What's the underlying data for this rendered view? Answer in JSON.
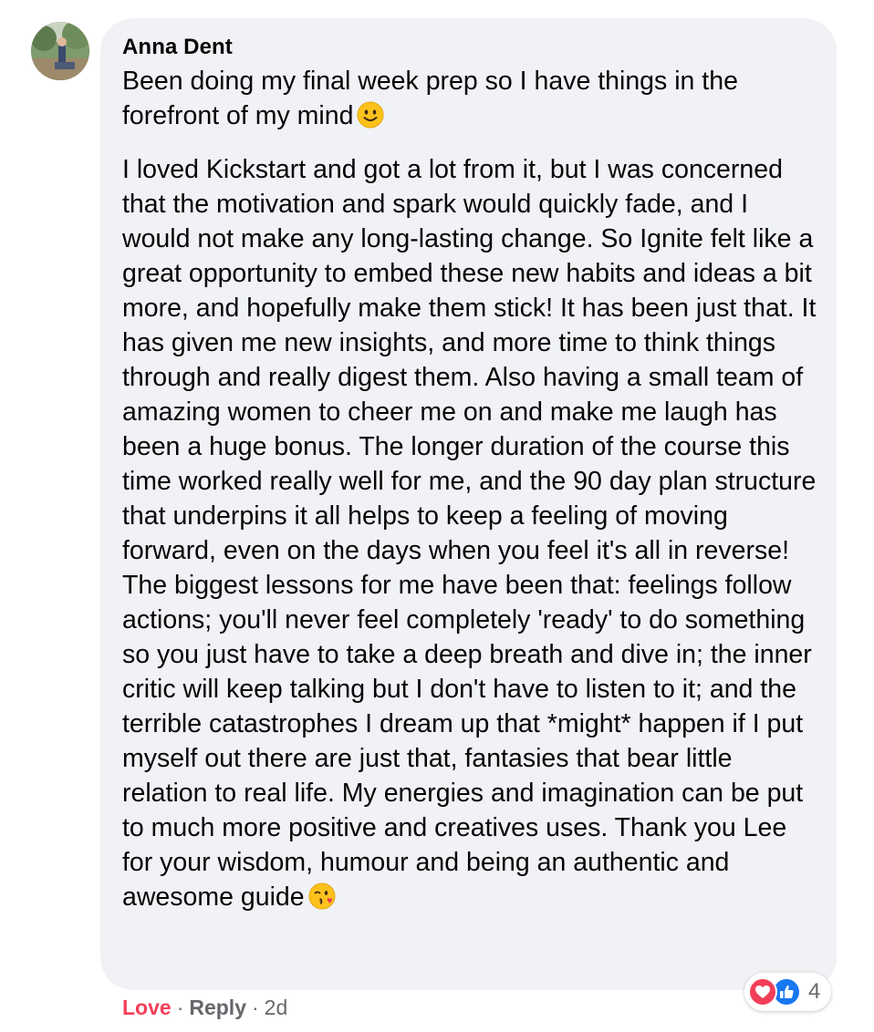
{
  "comment": {
    "author": "Anna Dent",
    "paragraphs": [
      "Been doing my final week prep so I have things in the forefront of my mind",
      "I loved Kickstart and got a lot from it, but I was concerned that the motivation and spark would quickly fade, and I would not make any long-lasting change. So Ignite felt like a great opportunity to embed these new habits and ideas a bit more, and hopefully make them stick! It has been just that. It has given me new insights, and more time to think things through and really digest them. Also having a small team of amazing women to cheer me on and make me laugh has been a huge bonus. The longer duration of the course this time worked really well for me, and the 90 day plan structure that underpins it all helps to keep a feeling of moving forward, even on the days when you feel it's all in reverse! The biggest lessons for me have been that: feelings follow actions; you'll never feel completely 'ready' to do something so you just have to take a deep breath and dive in; the inner critic will keep talking but I don't have to listen to it; and the terrible catastrophes I dream up that *might* happen if I put myself out there are just that, fantasies that bear little relation to real life. My energies and imagination can be put to much more positive and creatives uses. Thank you Lee for your wisdom, humour and being an authentic and awesome guide"
    ],
    "emojis": [
      "slightly-smiling-face",
      "face-blowing-a-kiss"
    ]
  },
  "reactions": {
    "icons": [
      "love-reaction-icon",
      "like-reaction-icon"
    ],
    "count": "4"
  },
  "actions": {
    "love_label": "Love",
    "reply_label": "Reply",
    "separator": "·",
    "timestamp": "2d"
  },
  "colors": {
    "bubble_bg": "#f0f2f5",
    "love_red": "#f33e58",
    "like_blue": "#1877f2",
    "muted_text": "#65676b"
  }
}
